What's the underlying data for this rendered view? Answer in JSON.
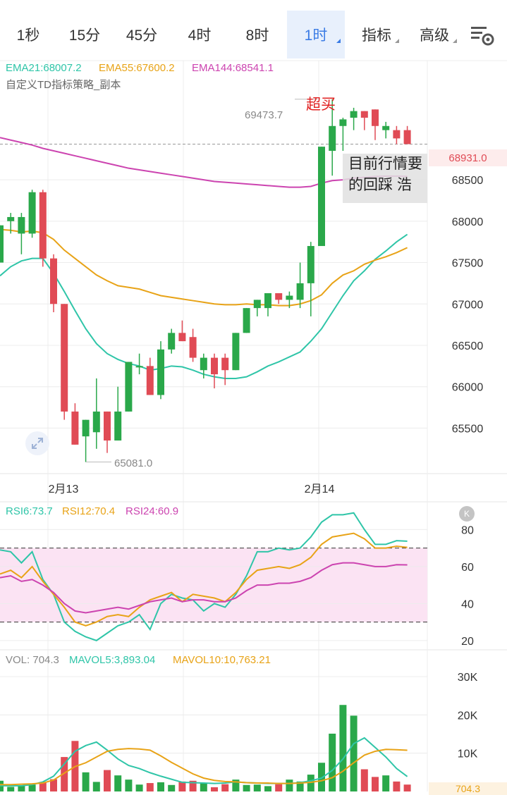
{
  "tabs": [
    {
      "label": "1秒",
      "active": false,
      "dropdown": false
    },
    {
      "label": "15分",
      "active": false,
      "dropdown": false
    },
    {
      "label": "45分",
      "active": false,
      "dropdown": false
    },
    {
      "label": "4时",
      "active": false,
      "dropdown": false
    },
    {
      "label": "8时",
      "active": false,
      "dropdown": false
    },
    {
      "label": "1时",
      "active": true,
      "dropdown": true
    },
    {
      "label": "指标",
      "active": false,
      "dropdown": true
    },
    {
      "label": "高级",
      "active": false,
      "dropdown": true
    }
  ],
  "settings_icon": "chart-settings-icon",
  "indicators": {
    "ema21": "EMA21:68007.2",
    "ema55": "EMA55:67600.2",
    "ema144": "EMA144:68541.1",
    "strategy": "自定义TD指标策略_副本",
    "rsi6": "RSI6:73.7",
    "rsi12": "RSI12:70.4",
    "rsi24": "RSI24:60.9",
    "vol": "VOL: 704.3",
    "mavol5": "MAVOL5:3,893.04",
    "mavol10": "MAVOL10:10,763.21"
  },
  "annotations": {
    "overbought": "超买",
    "high_label": "69473.7",
    "low_label": "65081.0",
    "overlay_line1": "目前行情要",
    "overlay_line2": "的回踩 浩",
    "current_price": "68931.0",
    "current_vol": "704.3",
    "k_button": "K"
  },
  "colors": {
    "up": "#2aa84a",
    "down": "#e04b55",
    "ema21": "#2fc5a8",
    "ema55": "#e8a317",
    "ema144": "#cc44b0",
    "rsi6": "#2fc5a8",
    "rsi12": "#e8a317",
    "rsi24": "#cc44b0",
    "grid": "#ececec",
    "axis_text": "#333333",
    "rsi_band": "#fbe3f3"
  },
  "chart_data": [
    {
      "type": "candlestick",
      "title": "",
      "x_ticks": [
        "2月13",
        "2月14"
      ],
      "y_ticks": [
        65500,
        66000,
        66500,
        67000,
        67500,
        68000,
        68500
      ],
      "ylim": [
        64950,
        69940
      ],
      "candles": [
        {
          "o": 67500,
          "h": 67950,
          "l": 67500,
          "c": 67950
        },
        {
          "o": 68000,
          "h": 68100,
          "l": 67850,
          "c": 68050
        },
        {
          "o": 67850,
          "h": 68100,
          "l": 67600,
          "c": 68050
        },
        {
          "o": 67850,
          "h": 68380,
          "l": 67800,
          "c": 68350
        },
        {
          "o": 68350,
          "h": 68380,
          "l": 67450,
          "c": 67550
        },
        {
          "o": 67550,
          "h": 67600,
          "l": 66900,
          "c": 67000
        },
        {
          "o": 67000,
          "h": 67000,
          "l": 65600,
          "c": 65700
        },
        {
          "o": 65700,
          "h": 65800,
          "l": 65300,
          "c": 65300
        },
        {
          "o": 65400,
          "h": 65550,
          "l": 65090,
          "c": 65600
        },
        {
          "o": 65450,
          "h": 66100,
          "l": 65250,
          "c": 65700
        },
        {
          "o": 65700,
          "h": 65700,
          "l": 65200,
          "c": 65350
        },
        {
          "o": 65350,
          "h": 66000,
          "l": 65350,
          "c": 65700
        },
        {
          "o": 65700,
          "h": 66300,
          "l": 65700,
          "c": 66300
        },
        {
          "o": 66250,
          "h": 66400,
          "l": 66150,
          "c": 66250
        },
        {
          "o": 66250,
          "h": 66350,
          "l": 65900,
          "c": 65900
        },
        {
          "o": 65900,
          "h": 66550,
          "l": 65850,
          "c": 66450
        },
        {
          "o": 66450,
          "h": 66700,
          "l": 66400,
          "c": 66650
        },
        {
          "o": 66650,
          "h": 66800,
          "l": 66550,
          "c": 66550
        },
        {
          "o": 66600,
          "h": 66700,
          "l": 66300,
          "c": 66350
        },
        {
          "o": 66200,
          "h": 66400,
          "l": 66100,
          "c": 66350
        },
        {
          "o": 66350,
          "h": 66400,
          "l": 65980,
          "c": 66150
        },
        {
          "o": 66350,
          "h": 66400,
          "l": 66020,
          "c": 66200
        },
        {
          "o": 66200,
          "h": 66650,
          "l": 66200,
          "c": 66650
        },
        {
          "o": 66650,
          "h": 66950,
          "l": 66650,
          "c": 66950
        },
        {
          "o": 66950,
          "h": 67050,
          "l": 66850,
          "c": 67050
        },
        {
          "o": 66950,
          "h": 67130,
          "l": 66850,
          "c": 67130
        },
        {
          "o": 67130,
          "h": 67130,
          "l": 67000,
          "c": 67050
        },
        {
          "o": 67050,
          "h": 67150,
          "l": 66950,
          "c": 67100
        },
        {
          "o": 67050,
          "h": 67500,
          "l": 66950,
          "c": 67250
        },
        {
          "o": 67250,
          "h": 67750,
          "l": 66850,
          "c": 67700
        },
        {
          "o": 67700,
          "h": 68900,
          "l": 67700,
          "c": 68900
        },
        {
          "o": 68850,
          "h": 69473.7,
          "l": 68550,
          "c": 69150
        },
        {
          "o": 69150,
          "h": 69250,
          "l": 68850,
          "c": 69230
        },
        {
          "o": 69250,
          "h": 69370,
          "l": 69100,
          "c": 69330
        },
        {
          "o": 69330,
          "h": 69300,
          "l": 69100,
          "c": 69250
        },
        {
          "o": 69350,
          "h": 69250,
          "l": 68980,
          "c": 69150
        },
        {
          "o": 69100,
          "h": 69200,
          "l": 69000,
          "c": 69150
        },
        {
          "o": 69100,
          "h": 69150,
          "l": 68930,
          "c": 69000
        },
        {
          "o": 69100,
          "h": 69150,
          "l": 68950,
          "c": 68931
        }
      ],
      "series": [
        {
          "name": "EMA21",
          "values": [
            67340,
            67450,
            67520,
            67550,
            67550,
            67370,
            67150,
            66920,
            66700,
            66520,
            66400,
            66330,
            66280,
            66250,
            66200,
            66220,
            66250,
            66240,
            66200,
            66150,
            66120,
            66100,
            66100,
            66120,
            66180,
            66250,
            66300,
            66360,
            66420,
            66550,
            66700,
            66900,
            67100,
            67280,
            67400,
            67540,
            67640,
            67750,
            67840
          ]
        },
        {
          "name": "EMA55",
          "values": [
            67900,
            67890,
            67870,
            67880,
            67860,
            67780,
            67650,
            67550,
            67450,
            67350,
            67280,
            67220,
            67200,
            67180,
            67140,
            67100,
            67080,
            67060,
            67040,
            67020,
            67000,
            66990,
            66990,
            67000,
            66990,
            66990,
            66980,
            66980,
            67000,
            67040,
            67110,
            67250,
            67350,
            67400,
            67480,
            67530,
            67570,
            67620,
            67680
          ]
        },
        {
          "name": "EMA144",
          "values": [
            69010,
            68980,
            68950,
            68920,
            68880,
            68850,
            68820,
            68790,
            68760,
            68730,
            68700,
            68670,
            68640,
            68620,
            68600,
            68580,
            68560,
            68540,
            68520,
            68500,
            68480,
            68470,
            68460,
            68450,
            68440,
            68430,
            68420,
            68410,
            68410,
            68420,
            68460,
            68490,
            68500,
            68520,
            68530,
            68540,
            68545,
            68545,
            68541
          ]
        }
      ]
    },
    {
      "type": "line",
      "title": "",
      "y_ticks": [
        20,
        40,
        60,
        80
      ],
      "ylim": [
        15,
        95
      ],
      "band": [
        30,
        70
      ],
      "series": [
        {
          "name": "RSI6",
          "values": [
            69,
            68,
            62,
            68,
            53,
            45,
            30,
            25,
            22,
            20,
            24,
            28,
            30,
            34,
            26,
            40,
            45,
            43,
            42,
            36,
            40,
            38,
            45,
            55,
            68,
            68,
            70,
            69,
            70,
            76,
            84,
            88,
            88,
            89,
            80,
            72,
            72,
            74,
            73.7
          ]
        },
        {
          "name": "RSI12",
          "values": [
            56,
            58,
            54,
            60,
            52,
            45,
            38,
            30,
            28,
            30,
            33,
            34,
            33,
            38,
            42,
            44,
            46,
            41,
            45,
            44,
            43,
            41,
            46,
            53,
            58,
            59,
            60,
            59,
            61,
            65,
            72,
            76,
            77,
            78,
            75,
            70,
            70,
            71,
            70.4
          ]
        },
        {
          "name": "RSI24",
          "values": [
            54,
            55,
            52,
            53,
            50,
            46,
            40,
            36,
            35,
            36,
            37,
            38,
            37,
            39,
            41,
            42,
            43,
            41,
            42,
            42,
            41,
            41,
            43,
            47,
            50,
            50,
            51,
            51,
            52,
            54,
            58,
            61,
            62,
            62,
            61,
            60,
            60,
            61,
            60.9
          ]
        }
      ]
    },
    {
      "type": "bar",
      "title": "",
      "y_ticks": [
        "10K",
        "20K",
        "30K"
      ],
      "ylim": [
        0,
        37000
      ],
      "values": [
        2800,
        1200,
        1500,
        1800,
        2500,
        3200,
        9000,
        13200,
        5000,
        2500,
        5600,
        4200,
        3100,
        1800,
        2200,
        2400,
        1700,
        2600,
        2800,
        2200,
        1100,
        1900,
        3100,
        1700,
        1800,
        1400,
        1900,
        3100,
        2600,
        4400,
        7500,
        15100,
        22600,
        19800,
        5800,
        3800,
        4200,
        2600,
        1800
      ],
      "series": [
        {
          "name": "MAVOL5",
          "values": [
            1500,
            1500,
            1500,
            1800,
            2500,
            4000,
            7200,
            10500,
            12000,
            12900,
            10800,
            8500,
            6800,
            6000,
            4900,
            4000,
            3200,
            2400,
            2300,
            2200,
            2100,
            2200,
            2500,
            2300,
            2200,
            2100,
            2100,
            2100,
            2300,
            2800,
            3500,
            5500,
            8500,
            12500,
            14000,
            11500,
            9000,
            6000,
            3893
          ]
        },
        {
          "name": "MAVOL10",
          "values": [
            1800,
            1800,
            1900,
            2000,
            2200,
            3000,
            4800,
            6500,
            7500,
            9000,
            10500,
            11000,
            11200,
            11100,
            10800,
            9300,
            7600,
            6100,
            4600,
            3500,
            2900,
            2600,
            2500,
            2300,
            2200,
            2200,
            2100,
            2100,
            2200,
            2400,
            2800,
            3600,
            5300,
            7500,
            9500,
            10500,
            11000,
            10900,
            10763
          ]
        }
      ]
    }
  ]
}
